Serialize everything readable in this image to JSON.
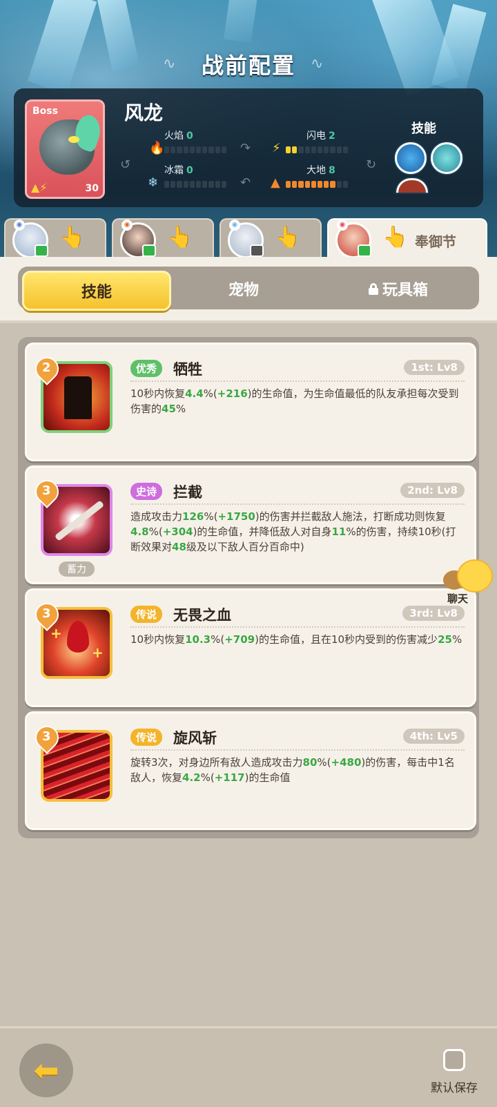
{
  "header": {
    "title": "战前配置"
  },
  "boss": {
    "tag": "Boss",
    "name": "风龙",
    "level": "30",
    "stats": {
      "fire": {
        "label": "火焰",
        "value": "0"
      },
      "lightning": {
        "label": "闪电",
        "value": "2"
      },
      "frost": {
        "label": "冰霜",
        "value": "0"
      },
      "earth": {
        "label": "大地",
        "value": "8"
      }
    },
    "skills_label": "技能"
  },
  "heroes": {
    "event_label": "奉御节"
  },
  "segment": {
    "tabs": [
      "技能",
      "宠物",
      "玩具箱"
    ],
    "selected": "技能"
  },
  "skills": [
    {
      "level": "2",
      "rarity": "优秀",
      "rarity_color": "#5fc06a",
      "name": "牺牲",
      "slot": "1st: Lv8",
      "desc_parts": [
        {
          "t": "10秒内恢复"
        },
        {
          "t": "4.4",
          "g": 1
        },
        {
          "t": "%("
        },
        {
          "t": "+216",
          "g": 1
        },
        {
          "t": ")的生命值，为生命值最低的队友承担每次受到伤害的"
        },
        {
          "t": "45",
          "g": 1
        },
        {
          "t": "%"
        }
      ]
    },
    {
      "level": "3",
      "rarity": "史诗",
      "rarity_color": "#cf6ce0",
      "name": "拦截",
      "slot": "2nd: Lv8",
      "charge": "蓄力",
      "desc_parts": [
        {
          "t": "造成攻击力"
        },
        {
          "t": "126",
          "g": 1
        },
        {
          "t": "%("
        },
        {
          "t": "+1750",
          "g": 1
        },
        {
          "t": ")的伤害并拦截敌人施法，打断成功则恢复"
        },
        {
          "t": "4.8",
          "g": 1
        },
        {
          "t": "%("
        },
        {
          "t": "+304",
          "g": 1
        },
        {
          "t": ")的生命值，并降低敌人对自身"
        },
        {
          "t": "11",
          "g": 1
        },
        {
          "t": "%的伤害，持续10秒(打断效果对"
        },
        {
          "t": "48",
          "g": 1
        },
        {
          "t": "级及以下敌人百分百命中)"
        }
      ]
    },
    {
      "level": "3",
      "rarity": "传说",
      "rarity_color": "#f3b42a",
      "name": "无畏之血",
      "slot": "3rd: Lv8",
      "desc_parts": [
        {
          "t": "10秒内恢复"
        },
        {
          "t": "10.3",
          "g": 1
        },
        {
          "t": "%("
        },
        {
          "t": "+709",
          "g": 1
        },
        {
          "t": ")的生命值，且在10秒内受到的伤害减少"
        },
        {
          "t": "25",
          "g": 1
        },
        {
          "t": "%"
        }
      ]
    },
    {
      "level": "3",
      "rarity": "传说",
      "rarity_color": "#f3b42a",
      "name": "旋风斩",
      "slot": "4th: Lv5",
      "desc_parts": [
        {
          "t": "旋转3次，对身边所有敌人造成攻击力"
        },
        {
          "t": "80",
          "g": 1
        },
        {
          "t": "%("
        },
        {
          "t": "+480",
          "g": 1
        },
        {
          "t": ")的伤害，每击中1名敌人，恢复"
        },
        {
          "t": "4.2",
          "g": 1
        },
        {
          "t": "%("
        },
        {
          "t": "+117",
          "g": 1
        },
        {
          "t": ")的生命值"
        }
      ]
    }
  ],
  "chat": {
    "label": "聊天"
  },
  "footer": {
    "save_label": "默认保存"
  }
}
